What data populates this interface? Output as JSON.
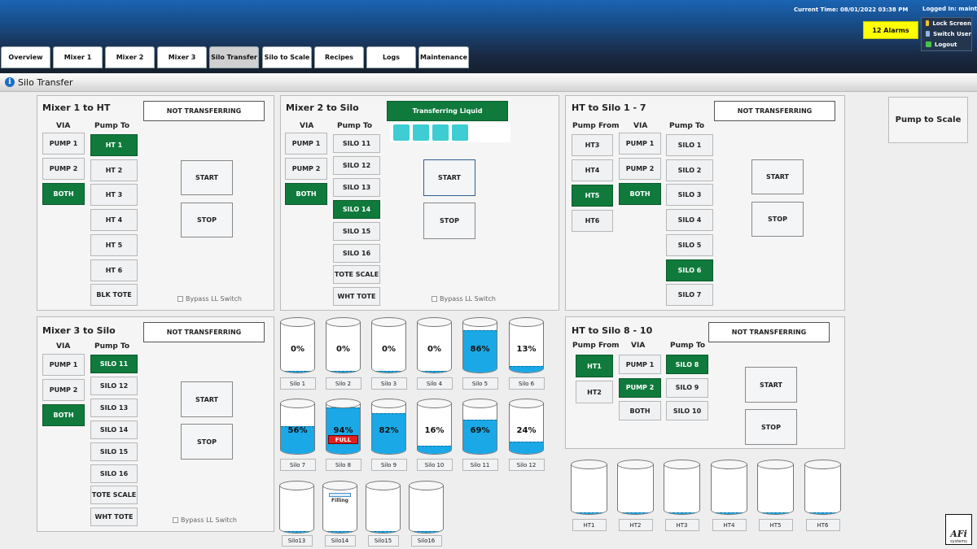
{
  "header": {
    "current_time": "Current Time: 08/01/2022 03:38 PM",
    "logged_in": "Logged In: maint",
    "alarms": "12 Alarms",
    "user_menu": [
      "Lock Screen",
      "Switch User",
      "Logout"
    ]
  },
  "tabs": [
    "Overview",
    "Mixer 1",
    "Mixer 2",
    "Mixer 3",
    "Silo Transfer",
    "Silo to Scale",
    "Recipes",
    "Logs",
    "Maintenance"
  ],
  "active_tab": "Silo Transfer",
  "page_title": "Silo Transfer",
  "common": {
    "via": "VIA",
    "pump_to": "Pump To",
    "pump_from": "Pump From",
    "start": "START",
    "stop": "STOP",
    "bypass": "Bypass LL Switch"
  },
  "mixer1": {
    "title": "Mixer 1 to HT",
    "status": "NOT TRANSFERRING",
    "via": [
      "PUMP 1",
      "PUMP 2",
      "BOTH"
    ],
    "via_selected": "BOTH",
    "pump_to": [
      "HT 1",
      "HT 2",
      "HT 3",
      "HT 4",
      "HT 5",
      "HT 6",
      "BLK TOTE"
    ],
    "pump_to_selected": "HT 1"
  },
  "mixer2": {
    "title": "Mixer 2 to Silo",
    "status": "Transferring Liquid",
    "via": [
      "PUMP 1",
      "PUMP 2",
      "BOTH"
    ],
    "via_selected": "BOTH",
    "pump_to": [
      "SILO 11",
      "SILO 12",
      "SILO 13",
      "SILO 14",
      "SILO 15",
      "SILO 16",
      "TOTE SCALE",
      "WHT TOTE"
    ],
    "pump_to_selected": "SILO 14"
  },
  "ht_silo17": {
    "title": "HT to Silo 1 - 7",
    "status": "NOT TRANSFERRING",
    "pump_from": [
      "HT3",
      "HT4",
      "HT5",
      "HT6"
    ],
    "pump_from_selected": "HT5",
    "via": [
      "PUMP 1",
      "PUMP 2",
      "BOTH"
    ],
    "via_selected": "BOTH",
    "pump_to": [
      "SILO 1",
      "SILO 2",
      "SILO 3",
      "SILO 4",
      "SILO 5",
      "SILO 6",
      "SILO 7"
    ],
    "pump_to_selected": "SILO 6"
  },
  "mixer3": {
    "title": "Mixer 3 to Silo",
    "status": "NOT TRANSFERRING",
    "via": [
      "PUMP 1",
      "PUMP 2",
      "BOTH"
    ],
    "via_selected": "BOTH",
    "pump_to": [
      "SILO 11",
      "SILO 12",
      "SILO 13",
      "SILO 14",
      "SILO 15",
      "SILO 16",
      "TOTE SCALE",
      "WHT TOTE"
    ],
    "pump_to_selected": "SILO 11"
  },
  "ht_silo810": {
    "title": "HT to Silo 8 - 10",
    "status": "NOT TRANSFERRING",
    "pump_from": [
      "HT1",
      "HT2"
    ],
    "pump_from_selected": "HT1",
    "via": [
      "PUMP 1",
      "PUMP 2",
      "BOTH"
    ],
    "via_selected": "PUMP 2",
    "pump_to": [
      "SILO 8",
      "SILO 9",
      "SILO 10"
    ],
    "pump_to_selected": "SILO 8"
  },
  "pump_to_scale": "Pump to Scale",
  "silos_row1": [
    {
      "name": "Silo 1",
      "pct": "0%",
      "level": 0
    },
    {
      "name": "Silo 2",
      "pct": "0%",
      "level": 0
    },
    {
      "name": "Silo 3",
      "pct": "0%",
      "level": 0
    },
    {
      "name": "Silo 4",
      "pct": "0%",
      "level": 0
    },
    {
      "name": "Silo 5",
      "pct": "86%",
      "level": 86
    },
    {
      "name": "Silo 6",
      "pct": "13%",
      "level": 13
    }
  ],
  "silos_row2": [
    {
      "name": "Silo 7",
      "pct": "56%",
      "level": 56
    },
    {
      "name": "Silo 8",
      "pct": "94%",
      "level": 94,
      "badge": "FULL"
    },
    {
      "name": "Silo 9",
      "pct": "82%",
      "level": 82
    },
    {
      "name": "Silo 10",
      "pct": "16%",
      "level": 16
    },
    {
      "name": "Silo 11",
      "pct": "69%",
      "level": 69
    },
    {
      "name": "Silo 12",
      "pct": "24%",
      "level": 24
    }
  ],
  "silos_row3": [
    {
      "name": "Silo13",
      "level": 0
    },
    {
      "name": "Silo14",
      "level": 0,
      "note": "Filling"
    },
    {
      "name": "Silo15",
      "level": 0
    },
    {
      "name": "Silo16",
      "level": 0
    }
  ],
  "hts": [
    {
      "name": "HT1",
      "level": 0
    },
    {
      "name": "HT2",
      "level": 0
    },
    {
      "name": "HT3",
      "level": 0
    },
    {
      "name": "HT4",
      "level": 0
    },
    {
      "name": "HT5",
      "level": 0
    },
    {
      "name": "HT6",
      "level": 0
    }
  ],
  "logo": {
    "mark": "AFi",
    "sub": "systems"
  },
  "colors": {
    "selected": "#0f7a3c",
    "liquid": "#1aa8e6",
    "alarm": "#ffff00",
    "full": "#e0201e"
  }
}
